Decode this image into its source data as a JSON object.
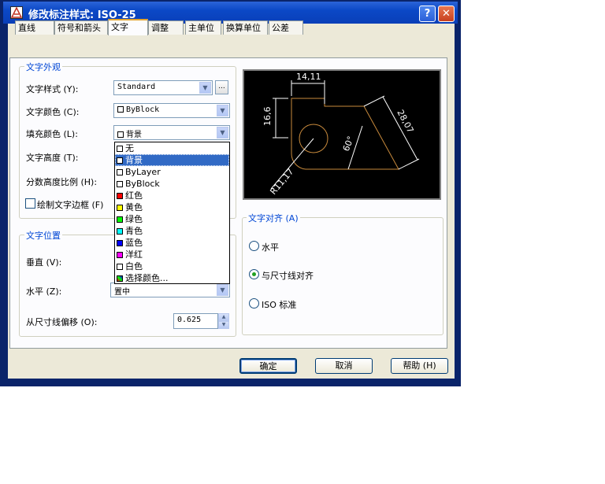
{
  "window": {
    "title": "修改标注样式: ISO-25",
    "help": "?",
    "close": "✕"
  },
  "tabs": [
    "直线",
    "符号和箭头",
    "文字",
    "调整",
    "主单位",
    "换算单位",
    "公差"
  ],
  "appearance": {
    "legend": "文字外观",
    "text_style_label": "文字样式 (Y):",
    "text_style_value": "Standard",
    "text_color_label": "文字颜色 (C):",
    "text_color_value": "ByBlock",
    "fill_color_label": "填充颜色 (L):",
    "fill_color_value": "背景",
    "text_height_label": "文字高度 (T):",
    "fraction_label": "分数高度比例 (H):",
    "frame_label": "绘制文字边框 (F)",
    "ellipsis": "..."
  },
  "color_list": [
    {
      "label": "无",
      "color": "#ffffff"
    },
    {
      "label": "背景",
      "color": "#ffffff"
    },
    {
      "label": "ByLayer",
      "color": "#ffffff"
    },
    {
      "label": "ByBlock",
      "color": "#ffffff"
    },
    {
      "label": "红色",
      "color": "#ff0000"
    },
    {
      "label": "黄色",
      "color": "#ffff00"
    },
    {
      "label": "绿色",
      "color": "#00ff00"
    },
    {
      "label": "青色",
      "color": "#00ffff"
    },
    {
      "label": "蓝色",
      "color": "#0000ff"
    },
    {
      "label": "洋红",
      "color": "#ff00ff"
    },
    {
      "label": "白色",
      "color": "#ffffff"
    },
    {
      "label": "选择颜色...",
      "color": "#cc66aa"
    }
  ],
  "placement": {
    "legend": "文字位置",
    "vertical_label": "垂直 (V):",
    "horizontal_label": "水平 (Z):",
    "horizontal_value": "置中",
    "offset_label": "从尺寸线偏移 (O):",
    "offset_value": "0.625"
  },
  "alignment": {
    "legend": "文字对齐 (A)",
    "opt_horizontal": "水平",
    "opt_aligned": "与尺寸线对齐",
    "opt_iso": "ISO 标准"
  },
  "preview": {
    "dim_top": "14,11",
    "dim_left": "16,6",
    "dim_diag": "28,07",
    "dim_angle": "60°",
    "dim_radius": "R11,17"
  },
  "buttons": {
    "ok": "确定",
    "cancel": "取消",
    "help": "帮助 (H)"
  }
}
